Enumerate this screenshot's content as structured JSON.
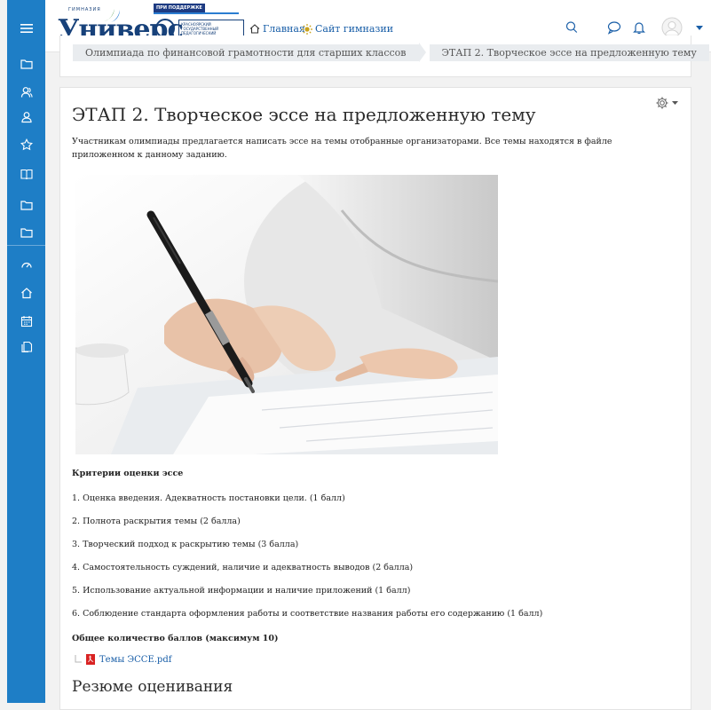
{
  "header": {
    "logo": {
      "wordmark": "Униве",
      "wordmark_tail": "рс",
      "gym_label": "ГИМНАЗИЯ",
      "support_tag": "ПРИ ПОДДЕРЖКЕ",
      "university": "КРАСНОЯРСКИЙ ГОСУДАРСТВЕННЫЙ ПЕДАГОГИЧЕСКИЙ УНИВЕРСИТЕТ ИМ. В. П. АСТАФЬЕВА"
    },
    "nav": {
      "home": "Главная",
      "site": "Сайт гимназии"
    }
  },
  "sidebar": {
    "icons": [
      "menu-icon",
      "folder-icon",
      "users-icon",
      "user-icon",
      "star-icon",
      "book-icon",
      "folder-icon",
      "folder-icon",
      "dashboard-icon",
      "home-icon",
      "calendar-icon",
      "files-icon"
    ]
  },
  "breadcrumb": {
    "items": [
      "Олимпиада по финансовой грамотности для старших классов",
      "ЭТАП 2. Творческое эссе на предложенную тему"
    ]
  },
  "content": {
    "title": "ЭТАП 2. Творческое эссе на предложенную тему",
    "intro": "Участникам олимпиады предлагается написать эссе на темы отобранные организаторами. Все темы находятся в файле приложенном к данному заданию.",
    "criteria_title": "Критерии оценки эссе",
    "criteria": [
      "1. Оценка введения. Адекватность постановки цели. (1 балл)",
      "2. Полнота раскрытия темы (2 балла)",
      "3. Творческий подход к раскрытию темы (3 балла)",
      "4. Самостоятельность суждений, наличие и адекватность выводов (2 балла)",
      "5. Использование актуальной информации и наличие приложений (1 балл)",
      "6. Соблюдение стандарта оформления работы и соответствие названия работы его содержанию (1 балл)"
    ],
    "total": "Общее количество баллов (максимум 10)",
    "file": "Темы ЭССЕ.pdf",
    "summary_heading": "Резюме оценивания"
  },
  "colors": {
    "sidebar": "#1e7ec6",
    "link": "#1a5fa8",
    "logo": "#17417a",
    "pdf": "#d92323"
  }
}
